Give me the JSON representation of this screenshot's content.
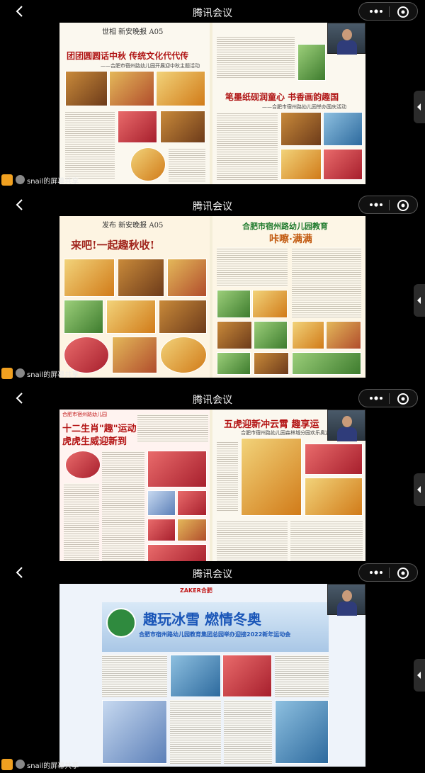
{
  "app": {
    "title": "腾讯会议",
    "share_label": "snail的屏幕共享"
  },
  "colors": {
    "background": "#000000",
    "share_icon": "#f0a020",
    "headline_red": "#b01515"
  },
  "icons": {
    "back": "chevron-left-icon",
    "more": "more-dots-icon",
    "close": "close-circle-icon",
    "side": "chevron-left-icon",
    "share": "screen-share-icon"
  },
  "panels": [
    {
      "masthead": "世相 新安晚报 A05",
      "left_headline": "团团圆圆话中秋 传统文化代代传",
      "left_sub": "——合肥市宿州路幼儿园开展迎中秋主题活动",
      "right_headline": "笔墨纸砚润童心 书香画韵趣国",
      "right_sub": "——合肥市宿州路幼儿园举办国庆活动"
    },
    {
      "masthead": "发布 新安晚报 A05",
      "left_headline": "来吧!一起趣秋收!",
      "right_headline": "合肥市宿州路幼儿园教育",
      "right_sub": "咔嚓·满满"
    },
    {
      "masthead": "合肥市宿州路幼儿园",
      "left_headline": "十二生肖\"趣\"运动",
      "left_sub": "虎虎生威迎新到",
      "right_headline": "五虎迎新冲云霄 趣享运",
      "right_sub": "合肥市宿州路幼儿园森林城分园欢乐奥运"
    },
    {
      "masthead": "ZAKER合肥",
      "headline": "趣玩冰雪 燃情冬奥",
      "sub": "合肥市宿州路幼儿园教育集团总园举办迎接2022新年运动会"
    }
  ]
}
